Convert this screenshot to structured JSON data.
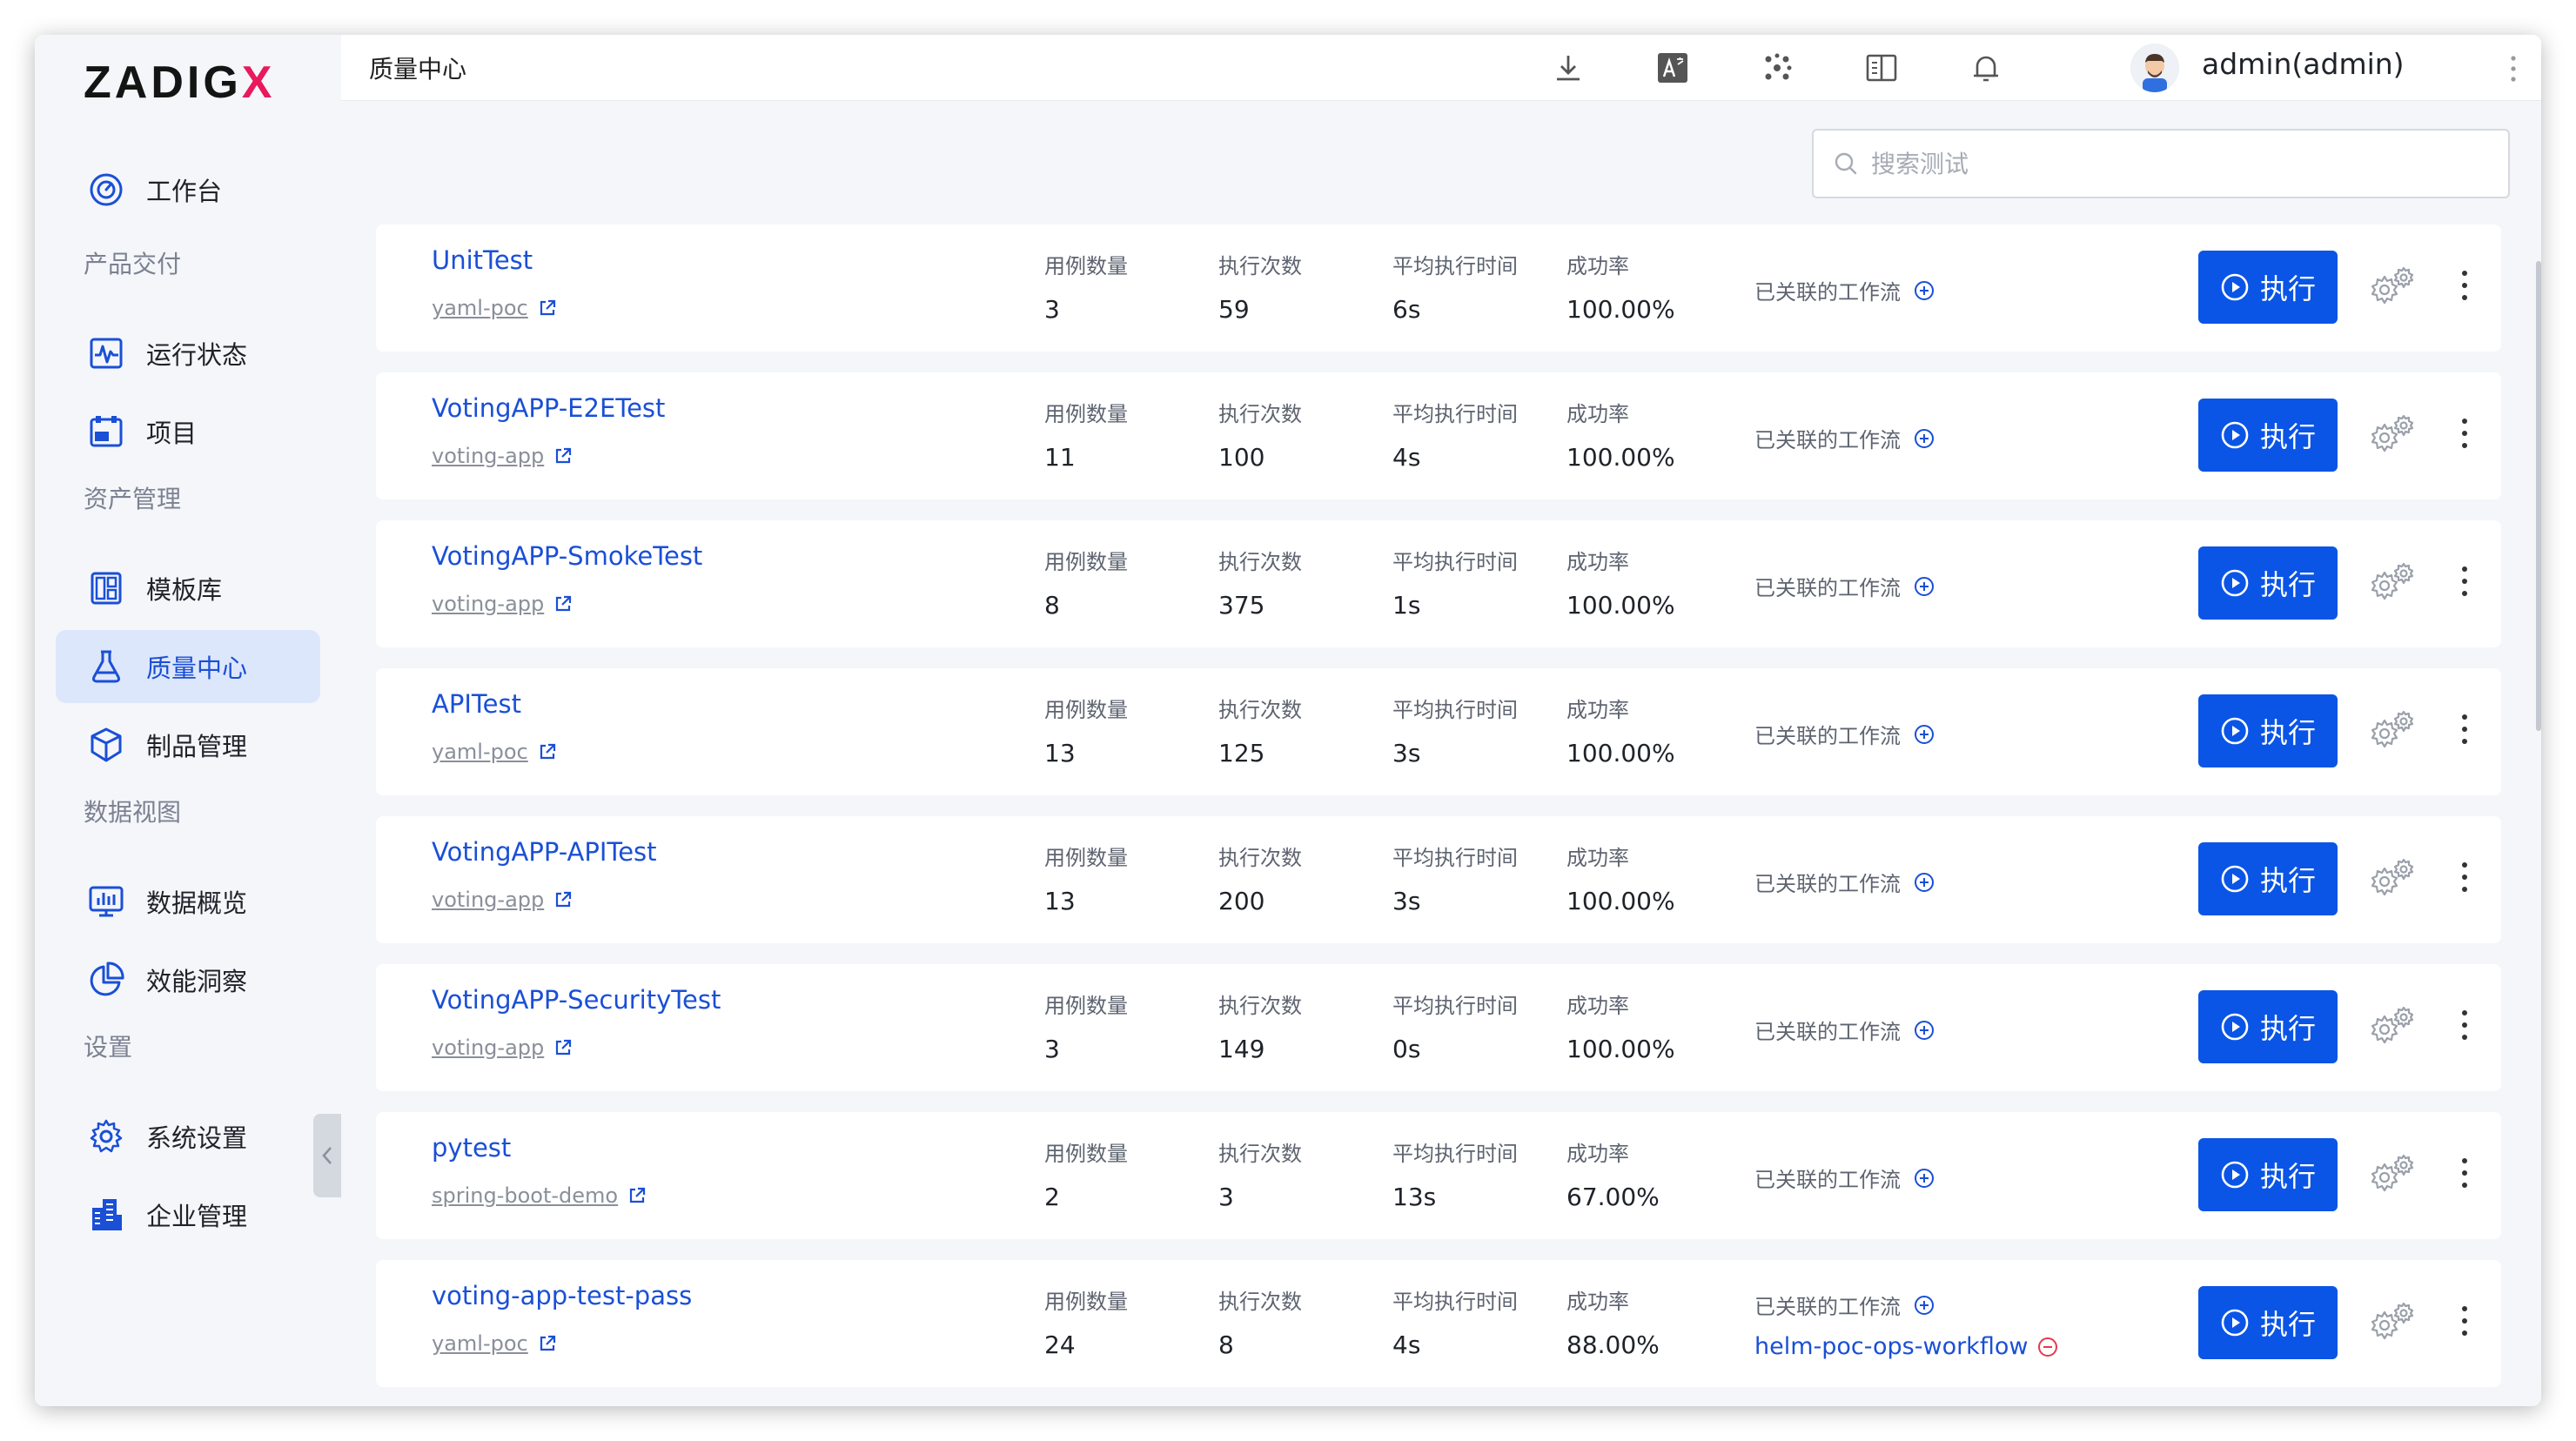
{
  "app": {
    "logo_main": "ZADIG",
    "logo_x": "X",
    "breadcrumb": "质量中心",
    "user": "admin(admin)"
  },
  "sidebar": {
    "workbench": "工作台",
    "sections": [
      {
        "title": "产品交付",
        "items": [
          {
            "label": "运行状态",
            "icon": "pulse-icon"
          },
          {
            "label": "项目",
            "icon": "project-icon"
          }
        ]
      },
      {
        "title": "资产管理",
        "items": [
          {
            "label": "模板库",
            "icon": "template-icon"
          },
          {
            "label": "质量中心",
            "icon": "flask-icon"
          },
          {
            "label": "制品管理",
            "icon": "artifact-icon"
          }
        ]
      },
      {
        "title": "数据视图",
        "items": [
          {
            "label": "数据概览",
            "icon": "chart-icon"
          },
          {
            "label": "效能洞察",
            "icon": "pie-icon"
          }
        ]
      },
      {
        "title": "设置",
        "items": [
          {
            "label": "系统设置",
            "icon": "gear-icon"
          },
          {
            "label": "企业管理",
            "icon": "building-icon"
          }
        ]
      }
    ]
  },
  "search": {
    "placeholder": "搜索测试"
  },
  "labels": {
    "cases": "用例数量",
    "runs": "执行次数",
    "avg_time": "平均执行时间",
    "success": "成功率",
    "linked": "已关联的工作流",
    "run": "执行"
  },
  "tests": [
    {
      "name": "UnitTest",
      "project": "yaml-poc",
      "cases": "3",
      "runs": "59",
      "avg": "6s",
      "rate": "100.00%"
    },
    {
      "name": "VotingAPP-E2ETest",
      "project": "voting-app",
      "cases": "11",
      "runs": "100",
      "avg": "4s",
      "rate": "100.00%"
    },
    {
      "name": "VotingAPP-SmokeTest",
      "project": "voting-app",
      "cases": "8",
      "runs": "375",
      "avg": "1s",
      "rate": "100.00%"
    },
    {
      "name": "APITest",
      "project": "yaml-poc",
      "cases": "13",
      "runs": "125",
      "avg": "3s",
      "rate": "100.00%"
    },
    {
      "name": "VotingAPP-APITest",
      "project": "voting-app",
      "cases": "13",
      "runs": "200",
      "avg": "3s",
      "rate": "100.00%"
    },
    {
      "name": "VotingAPP-SecurityTest",
      "project": "voting-app",
      "cases": "3",
      "runs": "149",
      "avg": "0s",
      "rate": "100.00%"
    },
    {
      "name": "pytest",
      "project": "spring-boot-demo",
      "cases": "2",
      "runs": "3",
      "avg": "13s",
      "rate": "67.00%"
    },
    {
      "name": "voting-app-test-pass",
      "project": "yaml-poc",
      "cases": "24",
      "runs": "8",
      "avg": "4s",
      "rate": "88.00%",
      "workflow": "helm-poc-ops-workflow"
    }
  ],
  "colors": {
    "accent": "#0a55e6",
    "link": "#1a4fd6",
    "brand_x": "#e8195c"
  }
}
